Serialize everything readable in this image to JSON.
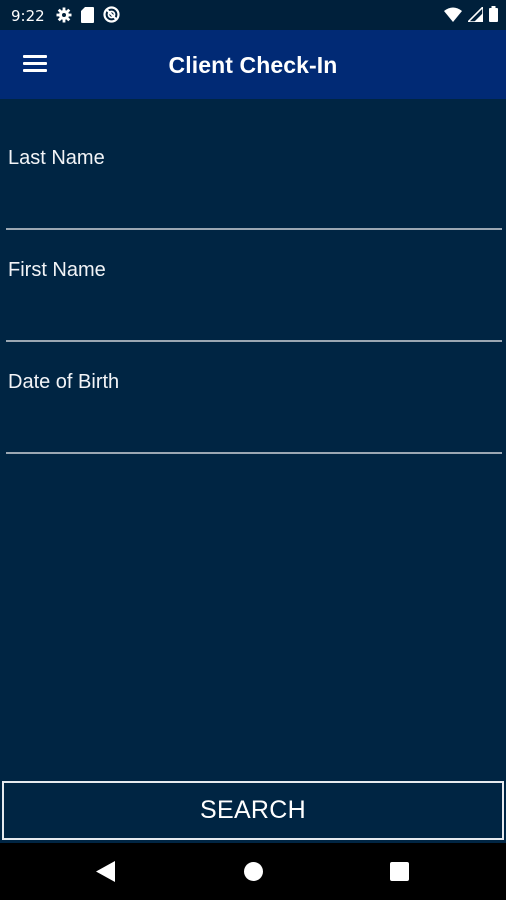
{
  "status_bar": {
    "time": "9:22",
    "left_icons": [
      "gear-icon",
      "sd-card-icon",
      "no-sync-icon"
    ],
    "right_icons": [
      "wifi-icon",
      "signal-icon",
      "battery-icon"
    ]
  },
  "app_bar": {
    "title": "Client Check-In",
    "menu_icon": "menu-icon"
  },
  "form": {
    "last_name": {
      "label": "Last Name",
      "value": ""
    },
    "first_name": {
      "label": "First Name",
      "value": ""
    },
    "dob": {
      "label": "Date of Birth",
      "value": ""
    }
  },
  "search_button": {
    "label": "SEARCH"
  },
  "nav_bar": {
    "icons": [
      "back-icon",
      "home-icon",
      "recents-icon"
    ]
  },
  "colors": {
    "background": "#002543",
    "app_bar": "#012a75",
    "status_bar": "#00203b",
    "divider": "#9ba7b3",
    "text": "#ffffff"
  }
}
